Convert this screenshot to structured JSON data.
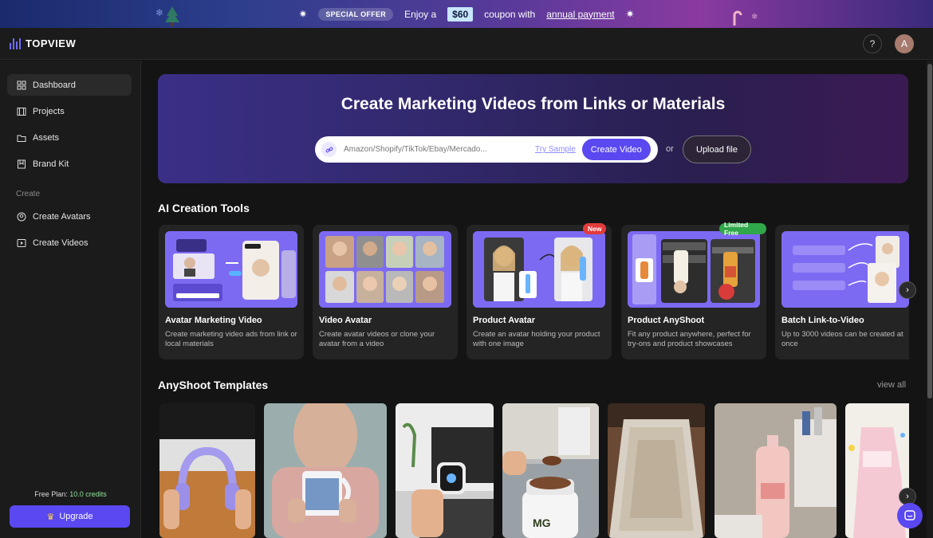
{
  "banner": {
    "badge": "SPECIAL OFFER",
    "text_before": "Enjoy a",
    "amount": "$60",
    "text_middle": "coupon with",
    "link": "annual payment"
  },
  "brand": {
    "name": "TOPVIEW"
  },
  "header": {
    "help": "?",
    "avatar_initial": "A"
  },
  "sidebar": {
    "items": [
      {
        "label": "Dashboard",
        "icon": "grid-icon"
      },
      {
        "label": "Projects",
        "icon": "film-icon"
      },
      {
        "label": "Assets",
        "icon": "folder-icon"
      },
      {
        "label": "Brand Kit",
        "icon": "bookmark-icon"
      }
    ],
    "section": "Create",
    "create_items": [
      {
        "label": "Create Avatars",
        "icon": "avatar-plus-icon"
      },
      {
        "label": "Create Videos",
        "icon": "video-plus-icon"
      }
    ],
    "plan_label": "Free Plan:",
    "credits": "10.0 credits",
    "upgrade": "Upgrade"
  },
  "hero": {
    "title": "Create Marketing Videos from Links or Materials",
    "placeholder": "Amazon/Shopify/TikTok/Ebay/Mercado...",
    "try_sample": "Try Sample",
    "create_button": "Create Video",
    "or": "or",
    "upload_button": "Upload file"
  },
  "tools": {
    "title": "AI Creation Tools",
    "cards": [
      {
        "title": "Avatar Marketing Video",
        "desc": "Create marketing video ads from link or local materials",
        "badge": ""
      },
      {
        "title": "Video Avatar",
        "desc": "Create avatar videos or clone your avatar from a video",
        "badge": ""
      },
      {
        "title": "Product Avatar",
        "desc": "Create an avatar holding your product with one image",
        "badge": "New"
      },
      {
        "title": "Product AnyShoot",
        "desc": "Fit any product anywhere, perfect for try-ons and product showcases",
        "badge": "Limited Free"
      },
      {
        "title": "Batch Link-to-Video",
        "desc": "Up to 3000 videos can be created at once",
        "badge": ""
      }
    ]
  },
  "templates": {
    "title": "AnyShoot Templates",
    "view_all": "view all"
  },
  "colors": {
    "accent": "#5a48f0",
    "new_badge": "#e23b3b",
    "free_badge": "#2fa74a",
    "credits": "#8fe39a"
  }
}
